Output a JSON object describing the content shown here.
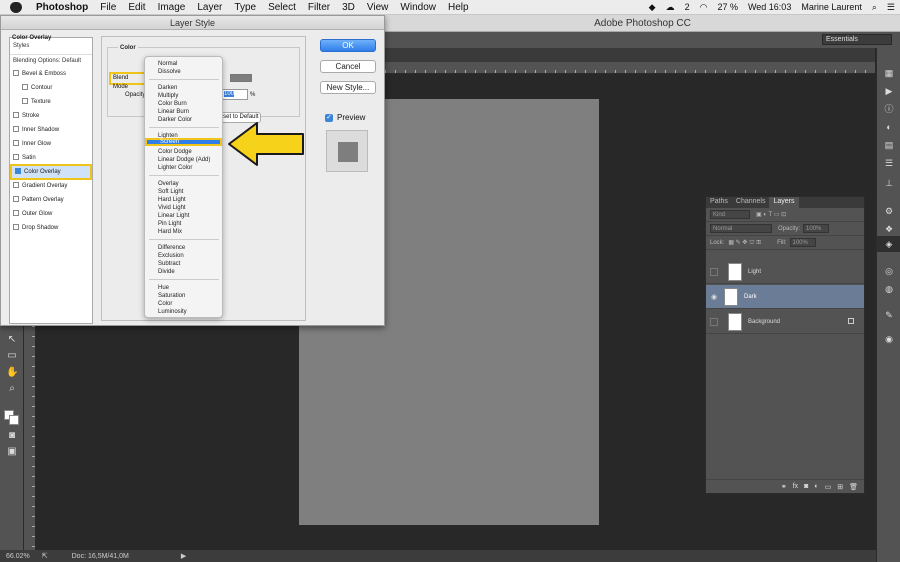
{
  "menubar": {
    "items": [
      "Photoshop",
      "File",
      "Edit",
      "Image",
      "Layer",
      "Type",
      "Select",
      "Filter",
      "3D",
      "View",
      "Window",
      "Help"
    ],
    "status_number": "2",
    "battery": "27 %",
    "clock": "Wed 16:03",
    "user": "Marine Laurent"
  },
  "app": {
    "title": "Adobe Photoshop CC",
    "workspace": "Essentials"
  },
  "dialog": {
    "title": "Layer Style",
    "styles_header": "Styles",
    "blending_options": "Blending Options: Default",
    "styles": [
      {
        "label": "Bevel & Emboss",
        "checked": false,
        "indent": false
      },
      {
        "label": "Contour",
        "checked": false,
        "indent": true
      },
      {
        "label": "Texture",
        "checked": false,
        "indent": true
      },
      {
        "label": "Stroke",
        "checked": false,
        "indent": false
      },
      {
        "label": "Inner Shadow",
        "checked": false,
        "indent": false
      },
      {
        "label": "Inner Glow",
        "checked": false,
        "indent": false
      },
      {
        "label": "Satin",
        "checked": false,
        "indent": false
      },
      {
        "label": "Color Overlay",
        "checked": true,
        "indent": false
      },
      {
        "label": "Gradient Overlay",
        "checked": false,
        "indent": false
      },
      {
        "label": "Pattern Overlay",
        "checked": false,
        "indent": false
      },
      {
        "label": "Outer Glow",
        "checked": false,
        "indent": false
      },
      {
        "label": "Drop Shadow",
        "checked": false,
        "indent": false
      }
    ],
    "group_title": "Color Overlay",
    "subgroup_title": "Color",
    "blend_mode_label": "Blend Mode",
    "opacity_label": "Opacity:",
    "opacity_value": "100",
    "opacity_unit": "%",
    "default_button": "Reset to Default",
    "ok_button": "OK",
    "cancel_button": "Cancel",
    "new_style_button": "New Style...",
    "preview_label": "Preview",
    "overlay_color": "#7e7e7e"
  },
  "blend_menu": {
    "groups": [
      [
        "Normal",
        "Dissolve"
      ],
      [
        "Darken",
        "Multiply",
        "Color Burn",
        "Linear Burn",
        "Darker Color"
      ],
      [
        "Lighten",
        "Screen",
        "Color Dodge",
        "Linear Dodge (Add)",
        "Lighter Color"
      ],
      [
        "Overlay",
        "Soft Light",
        "Hard Light",
        "Vivid Light",
        "Linear Light",
        "Pin Light",
        "Hard Mix"
      ],
      [
        "Difference",
        "Exclusion",
        "Subtract",
        "Divide"
      ],
      [
        "Hue",
        "Saturation",
        "Color",
        "Luminosity"
      ]
    ],
    "selected": "Screen"
  },
  "layers_panel": {
    "tabs": [
      "Paths",
      "Channels",
      "Layers"
    ],
    "active_tab": "Layers",
    "filter": "Kind",
    "blend_mode": "Normal",
    "opacity_label": "Opacity:",
    "opacity": "100%",
    "lock_label": "Lock:",
    "fill_label": "Fill:",
    "fill": "100%",
    "layers": [
      {
        "name": "Light",
        "visible": false,
        "selected": false
      },
      {
        "name": "Dark",
        "visible": true,
        "selected": true
      },
      {
        "name": "Background",
        "visible": false,
        "selected": false
      }
    ]
  },
  "status": {
    "zoom": "66.02%",
    "doc": "Doc: 16,5M/41,0M"
  }
}
